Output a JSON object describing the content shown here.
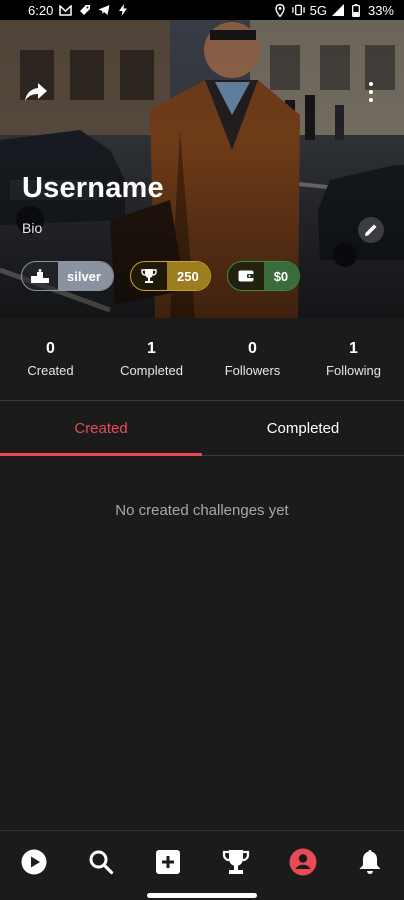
{
  "status_bar": {
    "time": "6:20",
    "network": "5G",
    "battery": "33%",
    "icons_left": [
      "gmail-icon",
      "tag-icon",
      "telegram-icon",
      "bolt-icon"
    ],
    "icons_right": [
      "location-icon",
      "vibrate-icon",
      "signal-icon",
      "battery-icon"
    ]
  },
  "profile": {
    "username": "Username",
    "bio": "Bio",
    "rank": {
      "icon": "podium-icon",
      "label": "silver"
    },
    "points": {
      "icon": "trophy-icon",
      "value": "250"
    },
    "wallet": {
      "icon": "wallet-icon",
      "value": "$0"
    }
  },
  "stats": [
    {
      "value": "0",
      "label": "Created"
    },
    {
      "value": "1",
      "label": "Completed"
    },
    {
      "value": "0",
      "label": "Followers"
    },
    {
      "value": "1",
      "label": "Following"
    }
  ],
  "tabs": [
    {
      "label": "Created",
      "active": true
    },
    {
      "label": "Completed",
      "active": false
    }
  ],
  "empty_message": "No created challenges yet",
  "bottom_nav": [
    {
      "icon": "play-icon",
      "active": false
    },
    {
      "icon": "search-icon",
      "active": false
    },
    {
      "icon": "add-icon",
      "active": false
    },
    {
      "icon": "trophy-icon",
      "active": false
    },
    {
      "icon": "profile-icon",
      "active": true
    }
  ],
  "colors": {
    "accent": "#e84b55",
    "background": "#1b1b1b",
    "rank": "#8c93a0",
    "points": "#c9a227",
    "wallet": "#3e8a46"
  }
}
